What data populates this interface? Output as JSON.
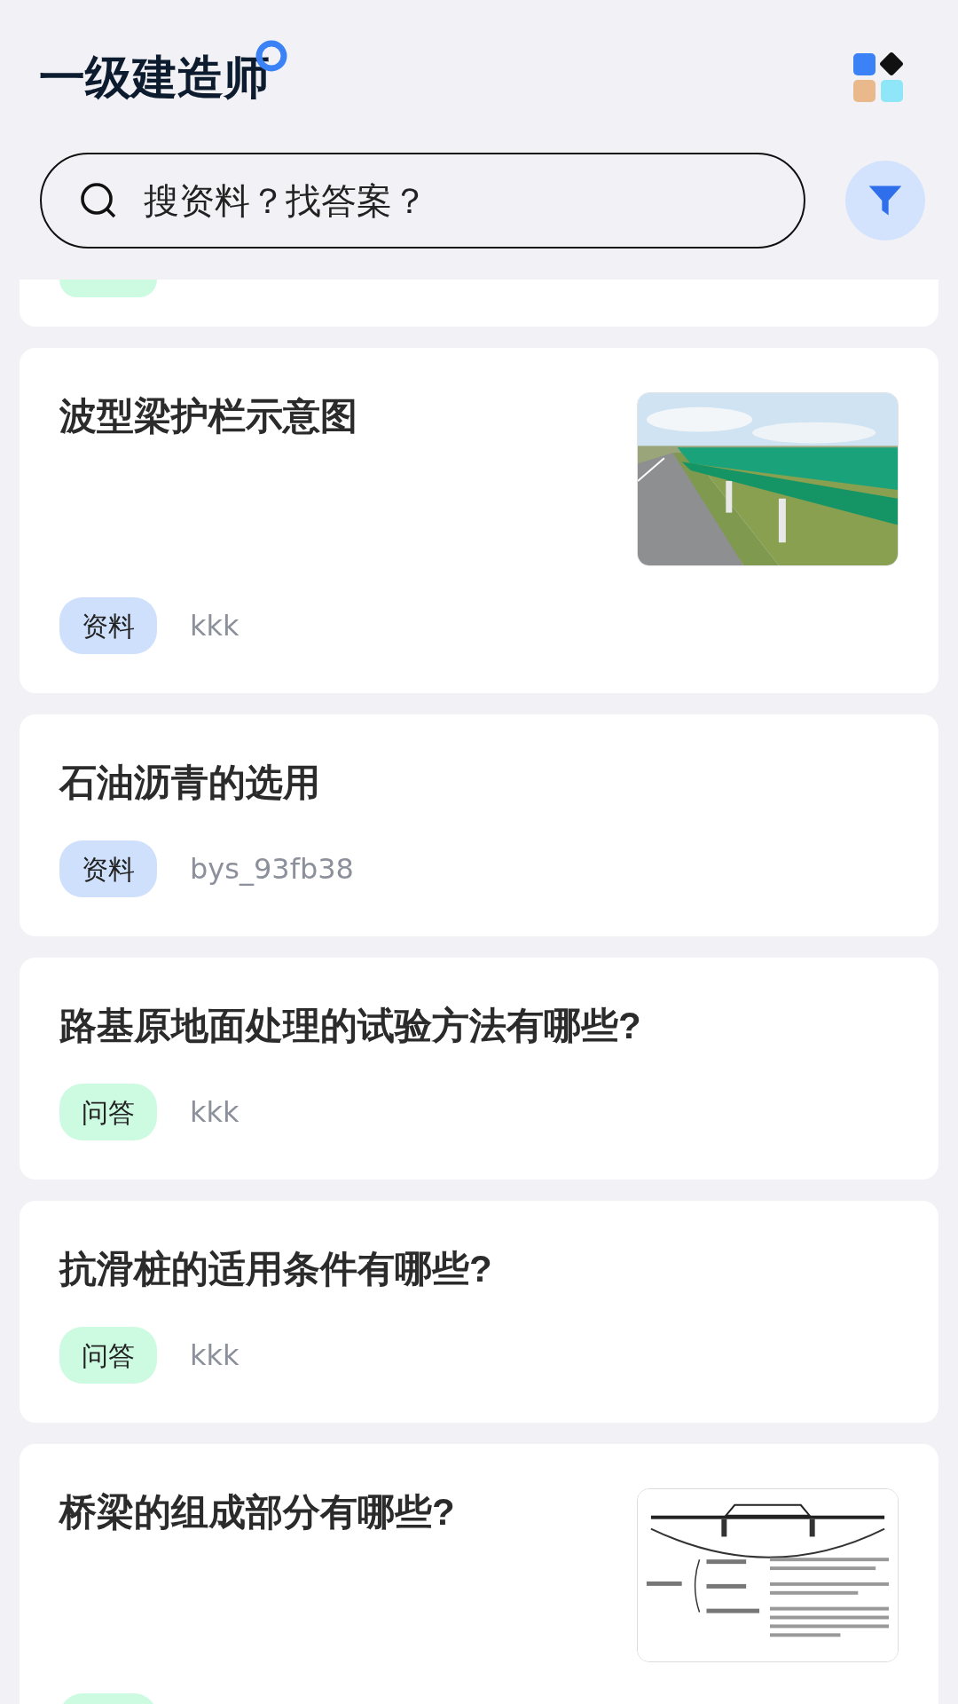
{
  "header": {
    "title": "一级建造师"
  },
  "search": {
    "placeholder": "搜资料？找答案？"
  },
  "partial_card": {
    "tag": {
      "kind": "qa"
    }
  },
  "items": [
    {
      "title": "波型梁护栏示意图",
      "tag": {
        "kind": "material",
        "label": "资料"
      },
      "author": "kkk"
    },
    {
      "title": "石油沥青的选用",
      "tag": {
        "kind": "material",
        "label": "资料"
      },
      "author": "bys_93fb38"
    },
    {
      "title": "路基原地面处理的试验方法有哪些?",
      "tag": {
        "kind": "qa",
        "label": "问答"
      },
      "author": "kkk"
    },
    {
      "title": "抗滑桩的适用条件有哪些?",
      "tag": {
        "kind": "qa",
        "label": "问答"
      },
      "author": "kkk"
    },
    {
      "title": "桥梁的组成部分有哪些?",
      "thumbnail": {
        "kind": "diagram"
      },
      "tag": {
        "kind": "qa"
      }
    }
  ]
}
